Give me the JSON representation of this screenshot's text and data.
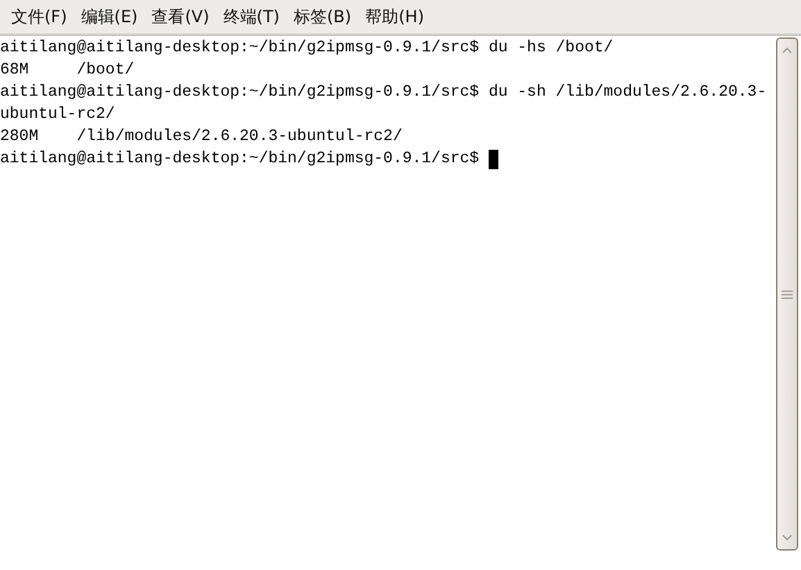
{
  "menu": [
    "文件(F)",
    "编辑(E)",
    "查看(V)",
    "终端(T)",
    "标签(B)",
    "帮助(H)"
  ],
  "terminal": {
    "lines": [
      "aitilang@aitilang-desktop:~/bin/g2ipmsg-0.9.1/src$ du -hs /boot/",
      "68M     /boot/",
      "aitilang@aitilang-desktop:~/bin/g2ipmsg-0.9.1/src$ du -sh /lib/modules/2.6.20.3-",
      "ubuntul-rc2/",
      "280M    /lib/modules/2.6.20.3-ubuntul-rc2/",
      "aitilang@aitilang-desktop:~/bin/g2ipmsg-0.9.1/src$ "
    ],
    "cursor": true
  }
}
